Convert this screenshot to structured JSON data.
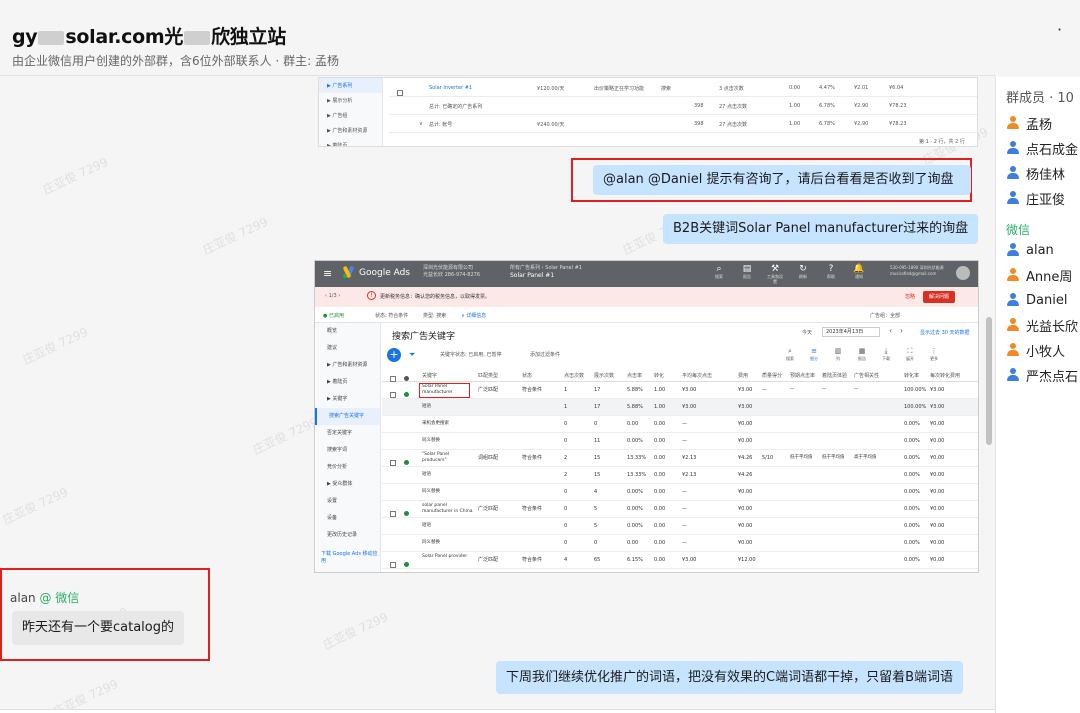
{
  "header": {
    "title_prefix": "gy",
    "title_mid": "solar.com光",
    "title_suffix": "欣独立站",
    "subtitle": "由企业微信用户创建的外部群，含6位外部联系人 · 群主: 孟杨",
    "more": "·"
  },
  "watermark": "庄亚俊 7299",
  "messages": {
    "m1": "@alan  @Daniel  提示有咨询了，请后台看看是否收到了询盘",
    "m2": "B2B关键词Solar Panel manufacturer过来的询盘",
    "m3_sender": "alan",
    "m3_tag": "@ 微信",
    "m3": "昨天还有一个要catalog的",
    "m4": "下周我们继续优化推广的词语，把没有效果的C端词语都干掉，只留着B端词语"
  },
  "shot1": {
    "nav": [
      "▶ 广告系列",
      "▶ 展示分析",
      "▶ 广告组",
      "▶ 广告和素材资源",
      "▶ 着陆页"
    ],
    "row1": [
      "Solar Inverter #1",
      "¥120.00/天",
      "出价策略正在学习功能",
      "搜索",
      "3 点击次数",
      "0.00",
      "4.47%",
      "¥2.01",
      "¥6.04"
    ],
    "row2": [
      "总计: 已确定的广告系列",
      "398",
      "27 点击次数",
      "1.00",
      "6.78%",
      "¥2.90",
      "¥78.23"
    ],
    "row3": [
      "总计: 帐号",
      "¥240.00/天",
      "398",
      "27 点击次数",
      "1.00",
      "6.78%",
      "¥2.90",
      "¥78.23"
    ],
    "pagination": "第 1 - 2 行，共 2 行"
  },
  "ads": {
    "app": "Google Ads",
    "account": "深圳光伏能源有限公司",
    "account_id": "光益长欣  286-974-8276",
    "campaign_label": "所有广告系列 › Solar Panel #1",
    "campaign": "Solar Panel #1",
    "tools": [
      {
        "icon": "⌕",
        "label": "搜索"
      },
      {
        "icon": "▤",
        "label": "报告"
      },
      {
        "icon": "⚒",
        "label": "工具和设置"
      },
      {
        "icon": "↻",
        "label": "刷新"
      },
      {
        "icon": "?",
        "label": "帮助"
      },
      {
        "icon": "🔔",
        "label": "通知"
      }
    ],
    "customer": "530-095-1890 深圳光伏能源 musicsfied@gmail.com",
    "alert_pager": "‹  1/3  ›",
    "alert_msg": "更新税务信息：确认您的税务信息，以取得发票。",
    "alert_dismiss": "忽略",
    "alert_fix": "解决问题",
    "filter_status": "● 已启用",
    "filter_state": "状态: 符合条件",
    "filter_type": "类型: 搜索",
    "filter_detail": "∨ 详细信息",
    "filter_right": "广告组：全部",
    "side": [
      "概览",
      "建议",
      "▶ 广告和素材资源",
      "▶ 着陆页",
      "▶ 关键字",
      "搜索广告关键字",
      "否定关键字",
      "搜索字词",
      "竞价分析",
      "▶ 受众群体",
      "设置",
      "设备",
      "更改历史记录"
    ],
    "side_download": "下载 Google Ads 移动应用",
    "heading": "搜索广告关键字",
    "date_label": "今天",
    "date_value": "2023年4月13日",
    "compare": "显示过去 30 天的数据",
    "filter_chip": "关键字状态: 已启用, 已暂停",
    "add_filter": "添加过滤条件",
    "icons": [
      {
        "icon": "⌕",
        "label": "搜索"
      },
      {
        "icon": "≡",
        "label": "细分"
      },
      {
        "icon": "▥",
        "label": "列"
      },
      {
        "icon": "▦",
        "label": "报告"
      },
      {
        "icon": "⤓",
        "label": "下载"
      },
      {
        "icon": "⛶",
        "label": "展开"
      },
      {
        "icon": "⋮",
        "label": "更多"
      }
    ],
    "columns": [
      "关键字",
      "匹配类型",
      "状态",
      "点击次数",
      "展示次数",
      "点击率",
      "转化",
      "平均每次点击",
      "费用",
      "质量得分",
      "预期点击率",
      "着陆页体验",
      "广告相关性",
      "转化率",
      "每次转化费用"
    ],
    "rows": [
      {
        "kw": "Solar Panel manufacturer",
        "match": "广泛匹配",
        "status": "符合条件",
        "clicks": "1",
        "impr": "17",
        "ctr": "5.88%",
        "conv": "1.00",
        "cpc": "¥3.00",
        "cost": "¥3.00",
        "qs": "—",
        "exp": "—",
        "land": "—",
        "rel": "—",
        "cvr": "100.00%",
        "cpa": "¥3.00",
        "main": true
      },
      {
        "kw": "短语",
        "clicks": "1",
        "impr": "17",
        "ctr": "5.88%",
        "conv": "1.00",
        "cpc": "¥3.00",
        "cost": "¥3.00",
        "cvr": "100.00%",
        "cpa": "¥3.00",
        "gray": true
      },
      {
        "kw": "采机会更搜索",
        "clicks": "0",
        "impr": "0",
        "ctr": "0.00",
        "conv": "0.00",
        "cpc": "—",
        "cost": "¥0.00",
        "cvr": "0.00%",
        "cpa": "¥0.00"
      },
      {
        "kw": "同义替换",
        "clicks": "0",
        "impr": "11",
        "ctr": "0.00%",
        "conv": "0.00",
        "cpc": "—",
        "cost": "¥0.00",
        "cvr": "0.00%",
        "cpa": "¥0.00"
      },
      {
        "kw": "\"Solar Panel producers\"",
        "match": "词组匹配",
        "status": "符合条件",
        "clicks": "2",
        "impr": "15",
        "ctr": "13.33%",
        "conv": "0.00",
        "cpc": "¥2.13",
        "cost": "¥4.26",
        "qs": "5/10",
        "exp": "低于平均值",
        "land": "低于平均值",
        "rel": "高于平均值",
        "cvr": "0.00%",
        "cpa": "¥0.00",
        "main": true
      },
      {
        "kw": "短语",
        "clicks": "2",
        "impr": "15",
        "ctr": "13.33%",
        "conv": "0.00",
        "cpc": "¥2.13",
        "cost": "¥4.26",
        "cvr": "0.00%",
        "cpa": "¥0.00"
      },
      {
        "kw": "同义替换",
        "clicks": "0",
        "impr": "4",
        "ctr": "0.00%",
        "conv": "0.00",
        "cpc": "—",
        "cost": "¥0.00",
        "cvr": "0.00%",
        "cpa": "¥0.00"
      },
      {
        "kw": "solar panel manufacturer in China",
        "match": "广泛匹配",
        "status": "符合条件",
        "clicks": "0",
        "impr": "5",
        "ctr": "0.00%",
        "conv": "0.00",
        "cpc": "—",
        "cost": "¥0.00",
        "cvr": "0.00%",
        "cpa": "¥0.00",
        "main": true
      },
      {
        "kw": "短语",
        "clicks": "0",
        "impr": "5",
        "ctr": "0.00%",
        "conv": "0.00",
        "cpc": "—",
        "cost": "¥0.00",
        "cvr": "0.00%",
        "cpa": "¥0.00"
      },
      {
        "kw": "同义替换",
        "clicks": "0",
        "impr": "0",
        "ctr": "0.00",
        "conv": "0.00",
        "cpc": "—",
        "cost": "¥0.00",
        "cvr": "0.00%",
        "cpa": "¥0.00"
      },
      {
        "kw": "Solar Panel provider",
        "match": "广泛匹配",
        "status": "符合条件",
        "clicks": "4",
        "impr": "65",
        "ctr": "6.15%",
        "conv": "0.00",
        "cpc": "¥3.00",
        "cost": "¥12.00",
        "cvr": "0.00%",
        "cpa": "¥0.00",
        "main": true
      }
    ]
  },
  "members": {
    "header": "群成员 · 10",
    "wechat_label": "微信",
    "list": [
      {
        "name": "孟杨",
        "color": "#f08a24"
      },
      {
        "name": "点石成金",
        "color": "#3d7fe0"
      },
      {
        "name": "杨佳林",
        "color": "#3d7fe0"
      },
      {
        "name": "庄亚俊",
        "color": "#3d7fe0"
      }
    ],
    "wechat_list": [
      {
        "name": "alan",
        "color": "#3d7fe0"
      },
      {
        "name": "Anne周",
        "color": "#f08a24"
      },
      {
        "name": "Daniel",
        "color": "#3d7fe0"
      },
      {
        "name": "光益长欣",
        "color": "#f08a24"
      },
      {
        "name": "小牧人",
        "color": "#f08a24"
      },
      {
        "name": "严杰点石",
        "color": "#3d7fe0"
      }
    ]
  }
}
